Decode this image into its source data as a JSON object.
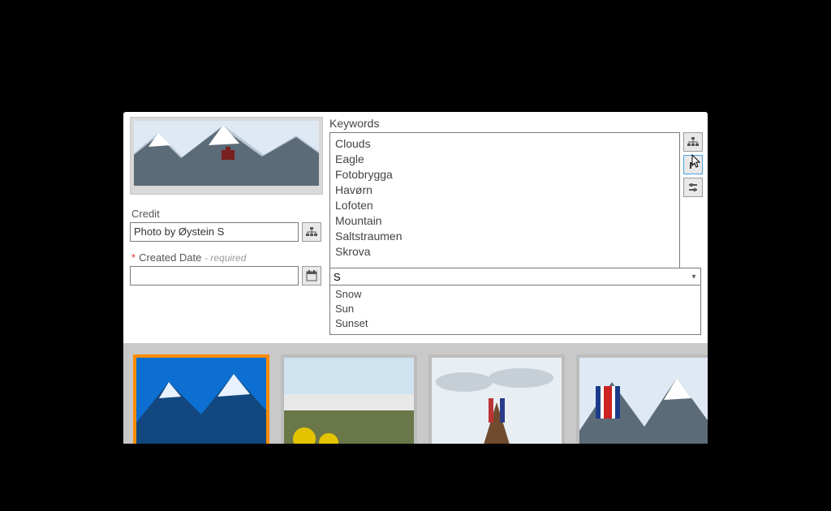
{
  "credit": {
    "label": "Credit",
    "value": "Photo by Øystein S"
  },
  "created_date": {
    "label": "Created Date",
    "required_text": "- required",
    "value": ""
  },
  "keywords": {
    "label": "Keywords",
    "items": [
      "Clouds",
      "Eagle",
      "Fotobrygga",
      "Havørn",
      "Lofoten",
      "Mountain",
      "Saltstraumen",
      "Skrova"
    ],
    "input_value": "S",
    "suggestions": [
      "Snow",
      "Sun",
      "Sunset"
    ]
  }
}
